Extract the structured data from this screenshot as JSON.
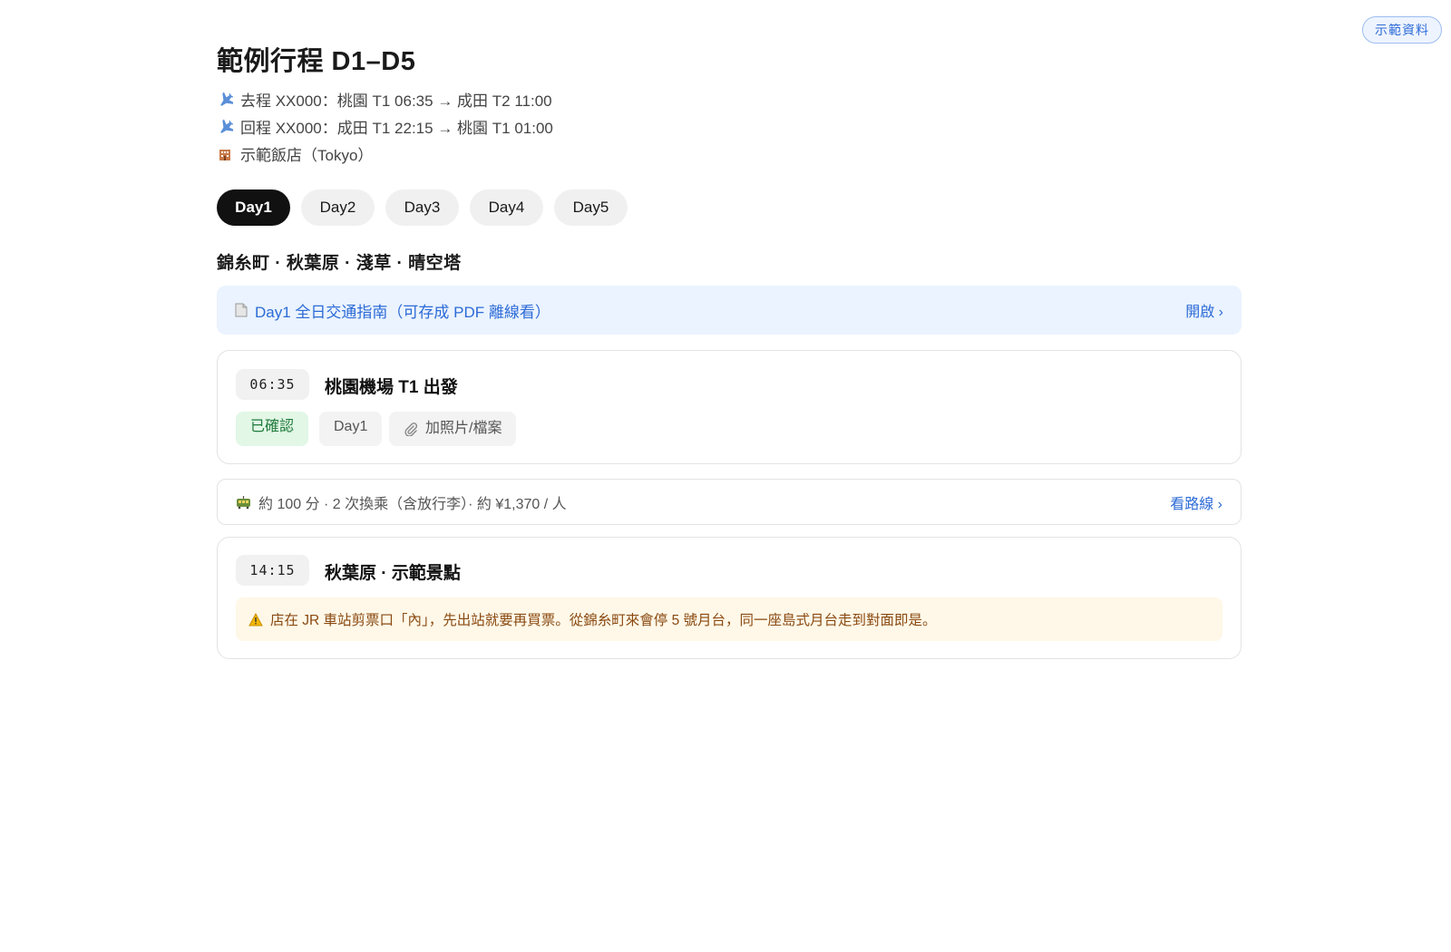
{
  "badge": "示範資料",
  "title": "範例行程 D1–D5",
  "info": {
    "outbound": "去程 XX000：桃園 T1 06:35 → 成田 T2 11:00",
    "return": "回程 XX000：成田 T1 22:15 → 桃園 T1 01:00",
    "hotel": "示範飯店（Tokyo）"
  },
  "tabs": [
    "Day1",
    "Day2",
    "Day3",
    "Day4",
    "Day5"
  ],
  "active_tab": "Day1",
  "day_heading": "錦糸町 · 秋葉原 · 淺草 · 晴空塔",
  "guide": {
    "label": "Day1 全日交通指南（可存成 PDF 離線看）",
    "action": "開啟 ›"
  },
  "events": [
    {
      "time": "06:35",
      "title": "桃園機場 T1 出發",
      "status": "已確認",
      "day_tag": "Day1",
      "attach_label": "加照片/檔案"
    },
    {
      "time": "14:15",
      "title": "秋葉原 · 示範景點",
      "warning": "店在 JR 車站剪票口「內」，先出站就要再買票。從錦糸町來會停 5 號月台，同一座島式月台走到對面即是。"
    }
  ],
  "transit": {
    "summary": "約 100 分 · 2 次換乘（含放行李）· 約 ¥1,370 / 人",
    "action": "看路線 ›"
  },
  "icons": {
    "plane": "airplane-icon",
    "hotel": "hotel-icon",
    "doc": "document-icon",
    "clip": "paperclip-icon",
    "tram": "tram-icon",
    "warning": "warning-icon"
  },
  "colors": {
    "accent": "#2d6bd6",
    "confirmed_bg": "#e2f7e6",
    "confirmed_text": "#1f7a3a",
    "warning_bg": "#fff8e8",
    "warning_text": "#8a4a12",
    "active_tab_bg": "#111111"
  }
}
